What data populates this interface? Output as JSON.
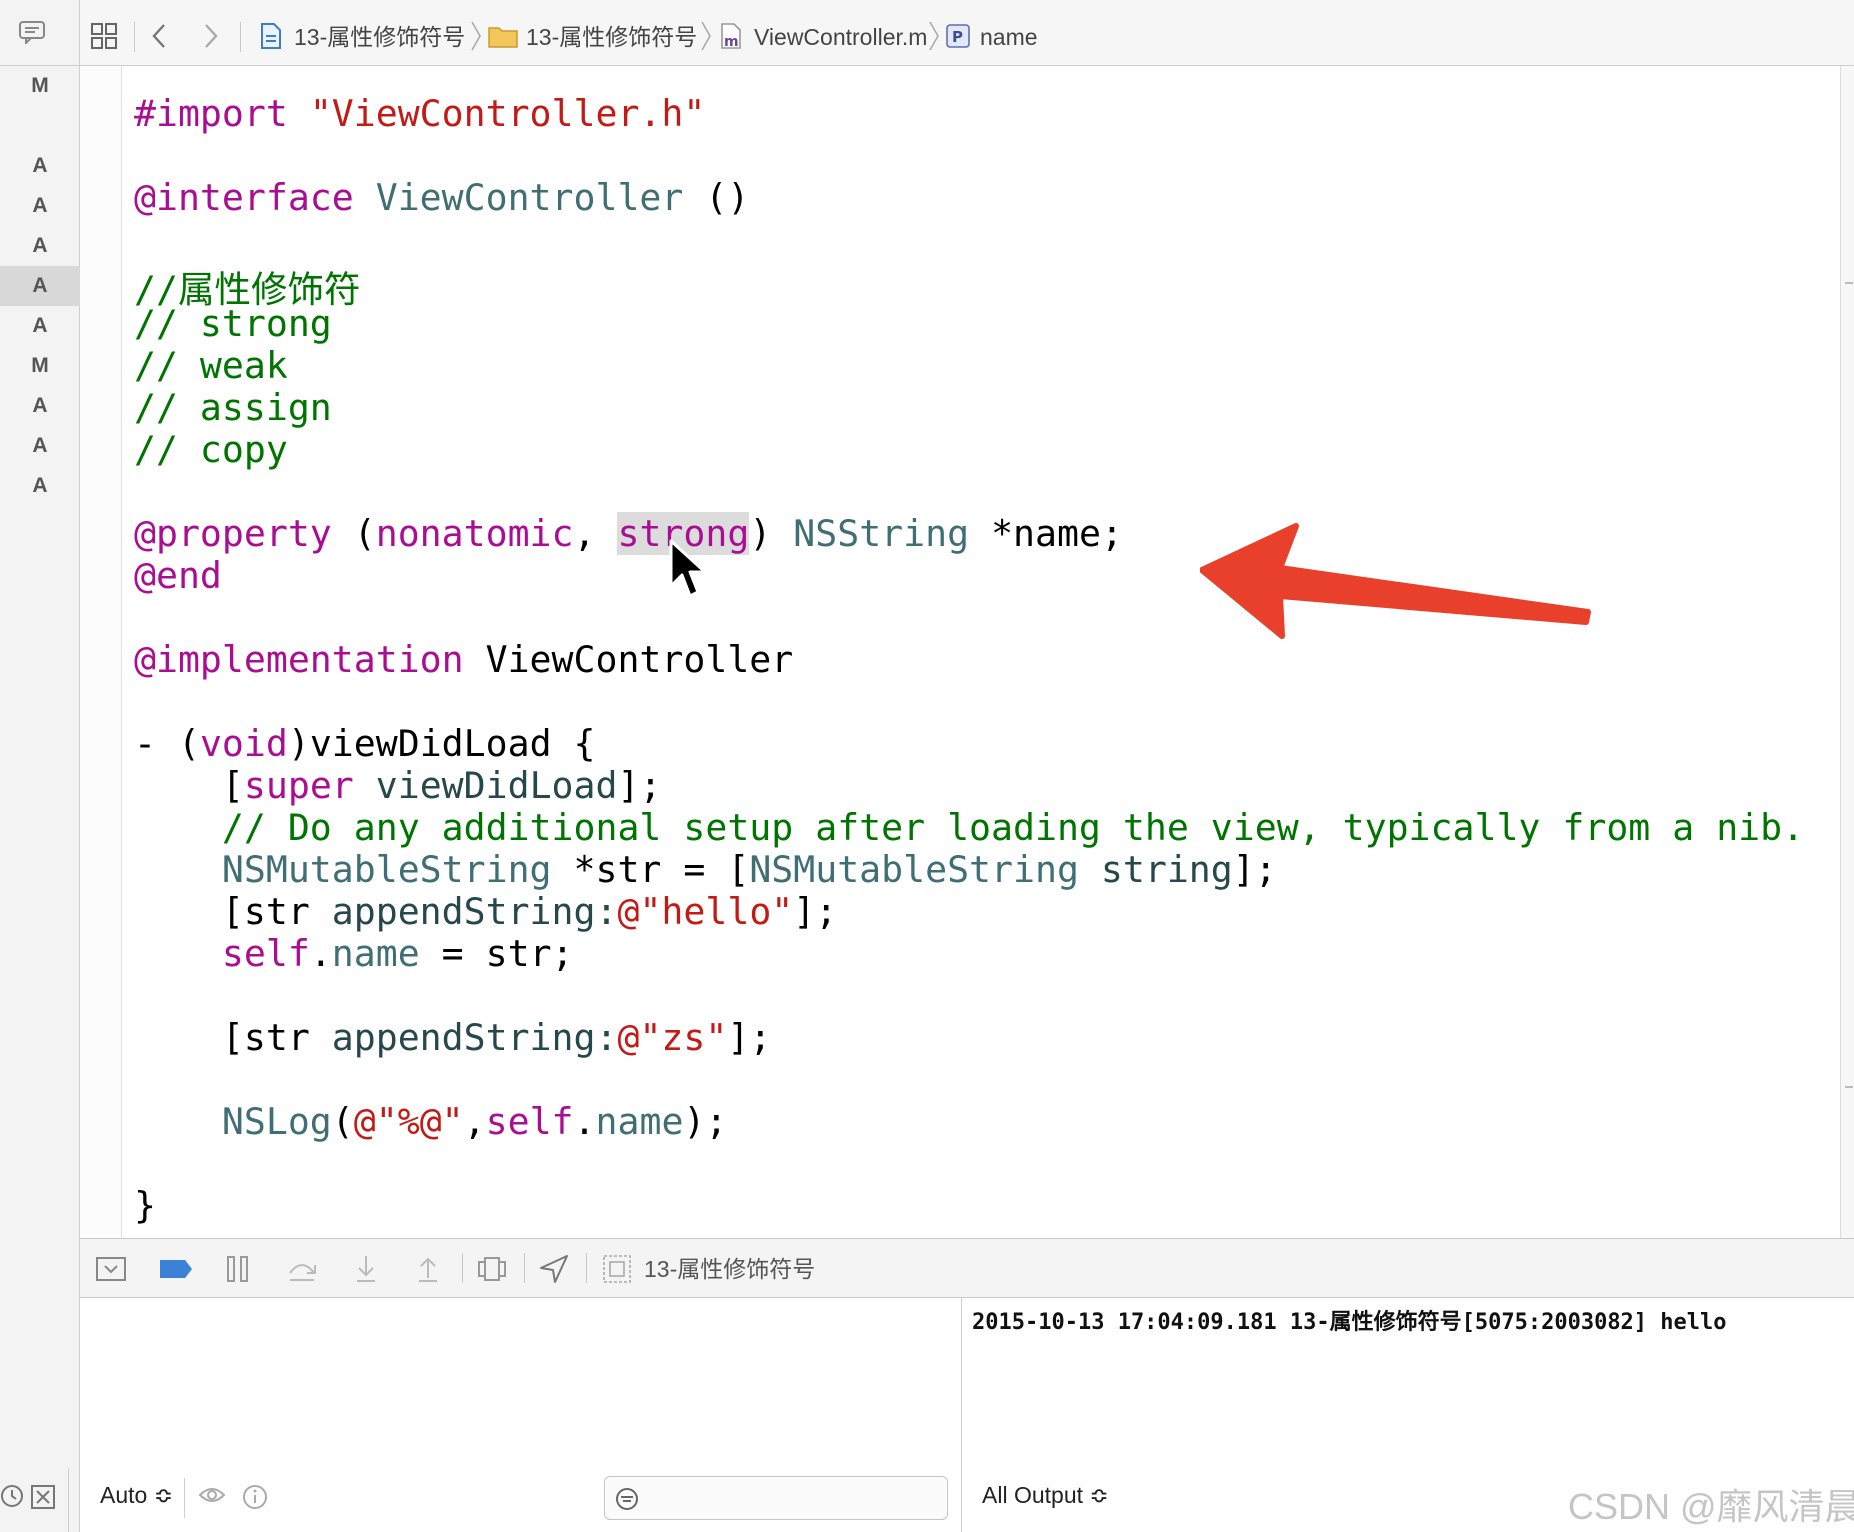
{
  "colors": {
    "keyword": "#aa0d91",
    "type": "#3f6e74",
    "method": "#26474b",
    "string": "#c41a16",
    "comment": "#007400",
    "annotation_arrow": "#e8402a"
  },
  "jumpbar": {
    "icons": [
      "related-items-icon",
      "grid-icon",
      "back-chevron-icon",
      "forward-chevron-icon"
    ],
    "crumbs": [
      {
        "icon": "project-file-icon",
        "label": "13-属性修饰符号"
      },
      {
        "icon": "folder-icon",
        "label": "13-属性修饰符号"
      },
      {
        "icon": "m-file-icon",
        "badge": "m",
        "label": "ViewController.m"
      },
      {
        "icon": "property-icon",
        "badge": "P",
        "label": "name"
      }
    ]
  },
  "scm_status": [
    "M",
    "A",
    "A",
    "A",
    "A",
    "A",
    "M",
    "A",
    "A",
    "A"
  ],
  "code": {
    "import_kw": "#import",
    "import_file": "\"ViewController.h\"",
    "interface_kw": "@interface",
    "interface_class": "ViewController",
    "interface_parens": " ()",
    "comment_title": "//属性修饰符",
    "comment_strong": "// strong",
    "comment_weak": "// weak",
    "comment_assign": "// assign",
    "comment_copy": "// copy",
    "property_kw": "@property",
    "property_open": " (",
    "property_nonatomic": "nonatomic",
    "property_comma": ", ",
    "property_strong": "strong",
    "property_close": ") ",
    "property_type": "NSString",
    "property_name": " *name;",
    "end_kw": "@end",
    "impl_kw": "@implementation",
    "impl_class": " ViewController",
    "method_dash": "- (",
    "method_void": "void",
    "method_name": ")viewDidLoad {",
    "super_open": "[",
    "super_kw": "super",
    "super_call": " viewDidLoad",
    "super_close": "];",
    "setup_comment": "// Do any additional setup after loading the view, typically from a nib.",
    "mstr_type": "NSMutableString",
    "mstr_var": " *str = [",
    "mstr_type2": "NSMutableString",
    "mstr_call": " string",
    "mstr_close": "];",
    "append1_open": "[str ",
    "append1_method": "appendString:",
    "append1_str": "@\"hello\"",
    "append1_close": "];",
    "self_kw": "self",
    "self_dot": ".",
    "self_name": "name",
    "self_assign": " = str;",
    "append2_open": "[str ",
    "append2_method": "appendString:",
    "append2_str": "@\"zs\"",
    "append2_close": "];",
    "nslog_fn": "NSLog",
    "nslog_open": "(",
    "nslog_fmt": "@\"%@\"",
    "nslog_comma": ",",
    "nslog_self": "self",
    "nslog_dot": ".",
    "nslog_name": "name",
    "nslog_close": ");",
    "brace_close": "}"
  },
  "debugbar": {
    "icons": [
      "hide-debug-area-icon",
      "breakpoints-toggle-icon",
      "pause-icon",
      "step-over-icon",
      "step-into-icon",
      "step-out-icon",
      "view-hierarchy-icon",
      "location-icon",
      "target-icon"
    ],
    "target_label": "13-属性修饰符号"
  },
  "console": {
    "line": "2015-10-13 17:04:09.181 13-属性修饰符号[5075:2003082] hello"
  },
  "bottom": {
    "auto_label": "Auto ≎",
    "output_label": "All Output ≎",
    "watermark": "CSDN @靡风清晨"
  }
}
